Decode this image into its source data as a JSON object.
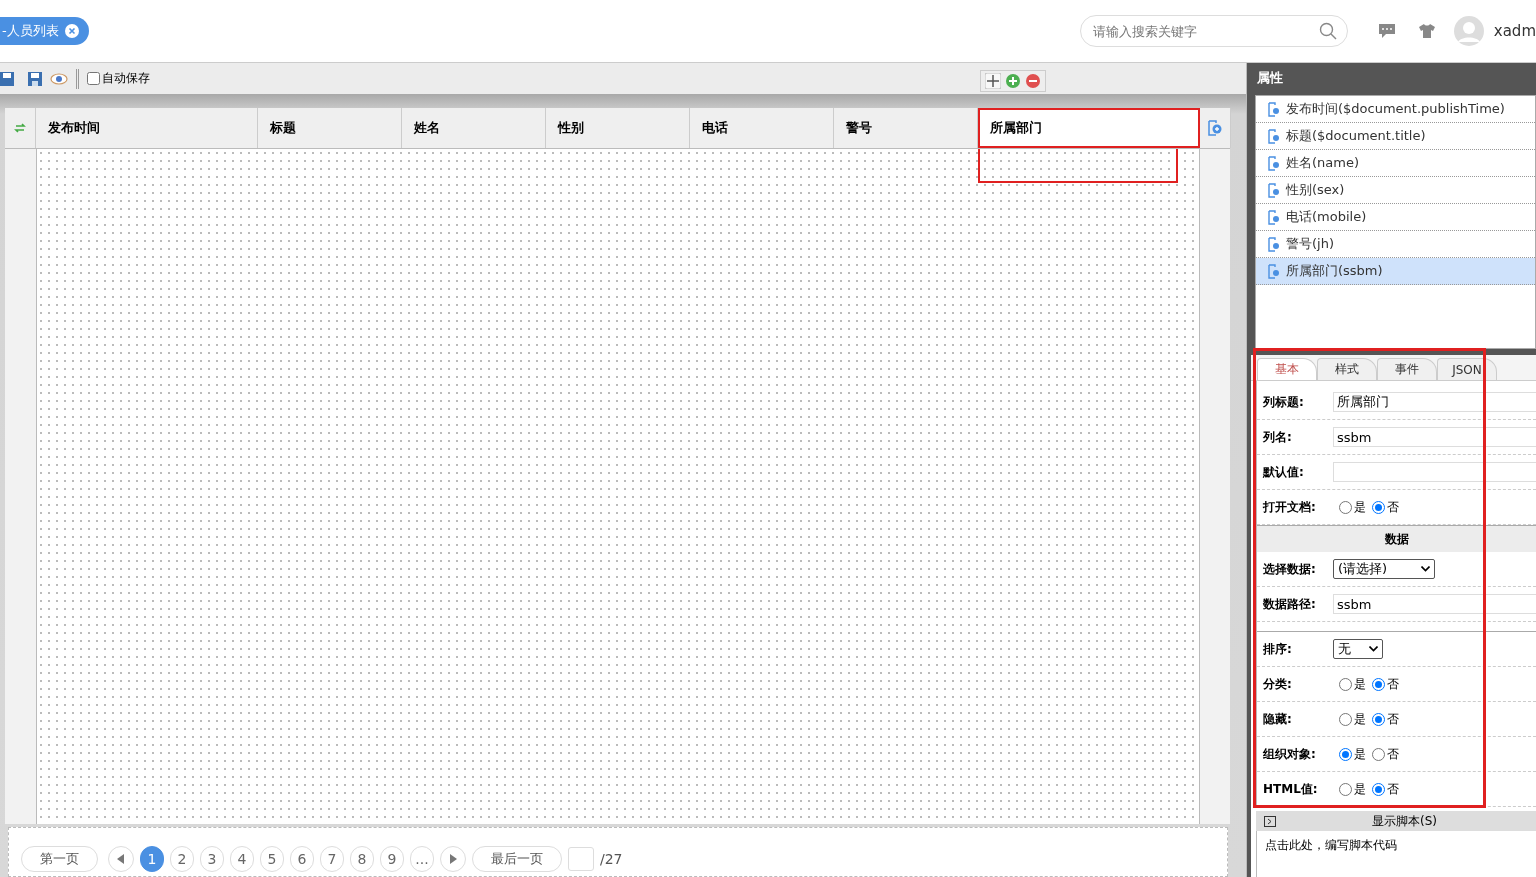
{
  "header": {
    "tab": {
      "label": "-人员列表"
    },
    "search": {
      "placeholder": "请输入搜索关键字"
    },
    "user": "xadm"
  },
  "toolbar": {
    "autosave": {
      "label": "自动保存",
      "checked": false
    }
  },
  "grid": {
    "columns": [
      {
        "label": "发布时间",
        "selected": false
      },
      {
        "label": "标题",
        "selected": false
      },
      {
        "label": "姓名",
        "selected": false
      },
      {
        "label": "性别",
        "selected": false
      },
      {
        "label": "电话",
        "selected": false
      },
      {
        "label": "警号",
        "selected": false
      },
      {
        "label": "所属部门",
        "selected": true
      }
    ]
  },
  "pager": {
    "first": "第一页",
    "pages": [
      {
        "label": "1",
        "selected": true
      },
      {
        "label": "2",
        "selected": false
      },
      {
        "label": "3",
        "selected": false
      },
      {
        "label": "4",
        "selected": false
      },
      {
        "label": "5",
        "selected": false
      },
      {
        "label": "6",
        "selected": false
      },
      {
        "label": "7",
        "selected": false
      },
      {
        "label": "8",
        "selected": false
      },
      {
        "label": "9",
        "selected": false
      },
      {
        "label": "...",
        "selected": false
      }
    ],
    "last": "最后一页",
    "total": "/27"
  },
  "properties": {
    "title": "属性",
    "fields": [
      {
        "label": "发布时间($document.publishTime)",
        "selected": false
      },
      {
        "label": "标题($document.title)",
        "selected": false
      },
      {
        "label": "姓名(name)",
        "selected": false
      },
      {
        "label": "性别(sex)",
        "selected": false
      },
      {
        "label": "电话(mobile)",
        "selected": false
      },
      {
        "label": "警号(jh)",
        "selected": false
      },
      {
        "label": "所属部门(ssbm)",
        "selected": true
      }
    ],
    "tabs": [
      {
        "label": "基本",
        "selected": true
      },
      {
        "label": "样式",
        "selected": false
      },
      {
        "label": "事件",
        "selected": false
      },
      {
        "label": "JSON",
        "selected": false
      }
    ],
    "form": [
      {
        "kind": "text",
        "label": "列标题:",
        "value": "所属部门"
      },
      {
        "kind": "text",
        "label": "列名:",
        "value": "ssbm"
      },
      {
        "kind": "text",
        "label": "默认值:"
      },
      {
        "kind": "radio",
        "label": "打开文档:",
        "options": [
          {
            "label": "是",
            "selected": false
          },
          {
            "label": "否",
            "selected": true
          }
        ]
      },
      {
        "kind": "section",
        "label": "数据"
      },
      {
        "kind": "select",
        "label": "选择数据:",
        "value": "(请选择)"
      },
      {
        "kind": "text",
        "label": "数据路径:",
        "value": "ssbm"
      },
      {
        "kind": "divider"
      },
      {
        "kind": "select",
        "label": "排序:",
        "value": "无"
      },
      {
        "kind": "radio",
        "label": "分类:",
        "options": [
          {
            "label": "是",
            "selected": false
          },
          {
            "label": "否",
            "selected": true
          }
        ]
      },
      {
        "kind": "radio",
        "label": "隐藏:",
        "options": [
          {
            "label": "是",
            "selected": false
          },
          {
            "label": "否",
            "selected": true
          }
        ]
      },
      {
        "kind": "radio",
        "label": "组织对象:",
        "options": [
          {
            "label": "是",
            "selected": true
          },
          {
            "label": "否",
            "selected": false
          }
        ]
      },
      {
        "kind": "radio",
        "label": "HTML值:",
        "options": [
          {
            "label": "是",
            "selected": false
          },
          {
            "label": "否",
            "selected": true
          }
        ]
      }
    ],
    "script": {
      "toggle": "显示脚本(S)",
      "hint": "点击此处，编写脚本代码"
    }
  }
}
